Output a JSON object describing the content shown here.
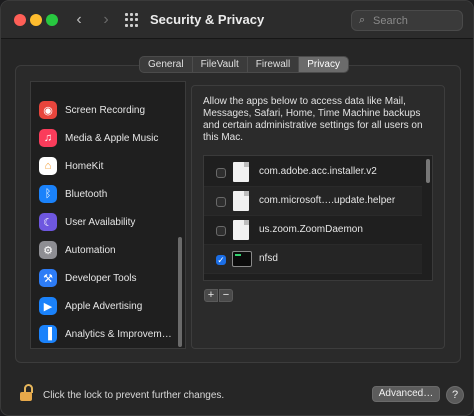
{
  "window": {
    "title": "Security & Privacy"
  },
  "toolbar": {
    "back_icon": "chevron-left-icon",
    "forward_icon": "chevron-right-icon",
    "show_all_icon": "grid-icon",
    "search_placeholder": "Search"
  },
  "tabs": [
    {
      "label": "General",
      "active": false
    },
    {
      "label": "FileVault",
      "active": false
    },
    {
      "label": "Firewall",
      "active": false
    },
    {
      "label": "Privacy",
      "active": true
    }
  ],
  "sidebar": {
    "items": [
      {
        "label": "Screen Recording",
        "icon": "screen-recording-icon",
        "color": "#e8453c"
      },
      {
        "label": "Media & Apple Music",
        "icon": "music-icon",
        "color": "#fa3c5b"
      },
      {
        "label": "HomeKit",
        "icon": "home-icon",
        "color": "#f29a2e"
      },
      {
        "label": "Bluetooth",
        "icon": "bluetooth-icon",
        "color": "#1a82fb"
      },
      {
        "label": "User Availability",
        "icon": "moon-icon",
        "color": "#6e57e0"
      },
      {
        "label": "Automation",
        "icon": "gear-icon",
        "color": "#8e8e93"
      },
      {
        "label": "Developer Tools",
        "icon": "developer-tools-icon",
        "color": "#2d7cf6"
      },
      {
        "label": "Apple Advertising",
        "icon": "megaphone-icon",
        "color": "#1a82fb"
      },
      {
        "label": "Analytics & Improvem…",
        "icon": "analytics-icon",
        "color": "#1a82fb"
      }
    ]
  },
  "privacy": {
    "description": "Allow the apps below to access data like Mail, Messages, Safari, Home, Time Machine backups and certain administrative settings for all users on this Mac.",
    "apps": [
      {
        "name": "com.adobe.acc.installer.v2",
        "checked": false,
        "icon": "document-icon"
      },
      {
        "name": "com.microsoft….update.helper",
        "checked": false,
        "icon": "document-icon"
      },
      {
        "name": "us.zoom.ZoomDaemon",
        "checked": false,
        "icon": "document-icon"
      },
      {
        "name": "nfsd",
        "checked": true,
        "icon": "terminal-icon"
      }
    ],
    "add_label": "+",
    "remove_label": "−"
  },
  "footer": {
    "lock_text": "Click the lock to prevent further changes.",
    "advanced_label": "Advanced…",
    "help_label": "?"
  }
}
